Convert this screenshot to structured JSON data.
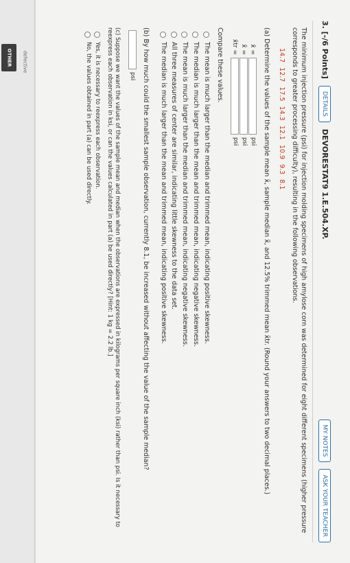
{
  "sidebar": {
    "tab_label": "OTHER",
    "text": "defective"
  },
  "header": {
    "question_number": "3. [-/6 Points]",
    "details_label": "DETAILS",
    "question_id": "DEVORESTAT9 1.E.504.XP.",
    "my_notes_label": "MY NOTES",
    "ask_teacher_label": "ASK YOUR TEACHER"
  },
  "intro": "The minimum injection pressure (psi) for injection molding specimens of high amylose corn was determined for eight different specimens (higher pressure corresponds to greater processing difficulty), resulting in the following observations.",
  "observations": "14.7  12.7  17.5  14.3  12.1  10.9  9.3  8.1",
  "part_a": {
    "prompt": "(a) Determine the values of the sample mean x̄, sample median x̃, and 12.5% trimmed mean x̄tr. (Round your answers to two decimal places.)",
    "fields": [
      {
        "label": "x̄ =",
        "unit": "psi"
      },
      {
        "label": "x̃ =",
        "unit": "psi"
      },
      {
        "label": "x̄tr =",
        "unit": "psi"
      }
    ],
    "compare_label": "Compare these values.",
    "options": [
      "The mean is much larger than the median and trimmed mean, indicating positive skewness.",
      "The median is much larger than the mean and trimmed mean, indicating negative skewness.",
      "The mean is much larger than the median and trimmed mean, indicating negative skewness.",
      "All three measures of center are similar, indicating little skewness to the data set.",
      "The median is much larger than the mean and trimmed mean, indicating positive skewness."
    ]
  },
  "part_b": {
    "prompt": "(b) By how much could the smallest sample observation, currently 8.1, be increased without affecting the value of the sample median?",
    "unit": "psi"
  },
  "part_c": {
    "prompt": "(c) Suppose we want the values of the sample mean and median when the observations are expressed in kilograms per square inch (ksi) rather than psi. Is it necessary to reexpress each observation in ksi, or can the values calculated in part (a) be used directly? [Hint: 1 kg = 2.2 lb.]",
    "options": [
      "Yes, it is necessary to reexpress each observation.",
      "No, the values obtained in part (a) can be used directly."
    ]
  }
}
